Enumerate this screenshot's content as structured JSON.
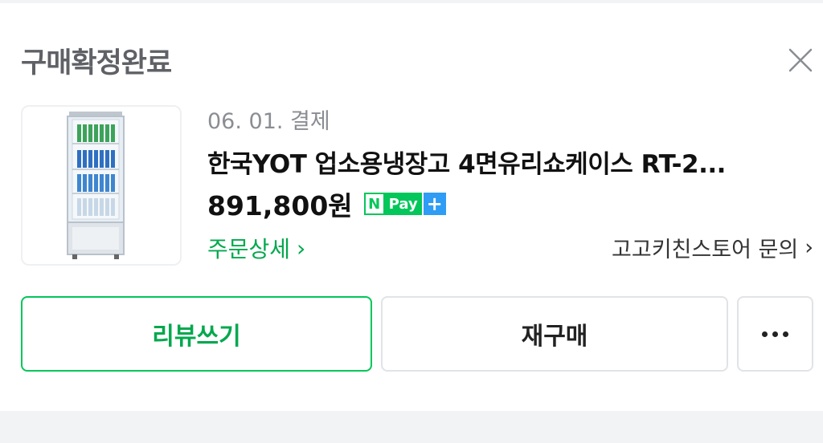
{
  "header": {
    "status_title": "구매확정완료",
    "close_icon": "close-icon"
  },
  "order": {
    "date": "06. 01. 결제",
    "product_name": "한국YOT 업소용냉장고 4면유리쇼케이스 RT-2...",
    "price": "891,800원",
    "payment_badge": {
      "n": "N",
      "pay": "Pay",
      "plus": "+"
    },
    "order_detail_link": "주문상세",
    "seller_link": "고고키친스토어 문의",
    "thumbnail_icon": "glass-showcase-fridge-image"
  },
  "actions": {
    "review_label": "리뷰쓰기",
    "rebuy_label": "재구매",
    "more_icon": "more-dots-icon"
  },
  "colors": {
    "accent_green": "#03c75a",
    "npay_plus_blue": "#2f9cf5",
    "title_gray": "#5f6166"
  }
}
